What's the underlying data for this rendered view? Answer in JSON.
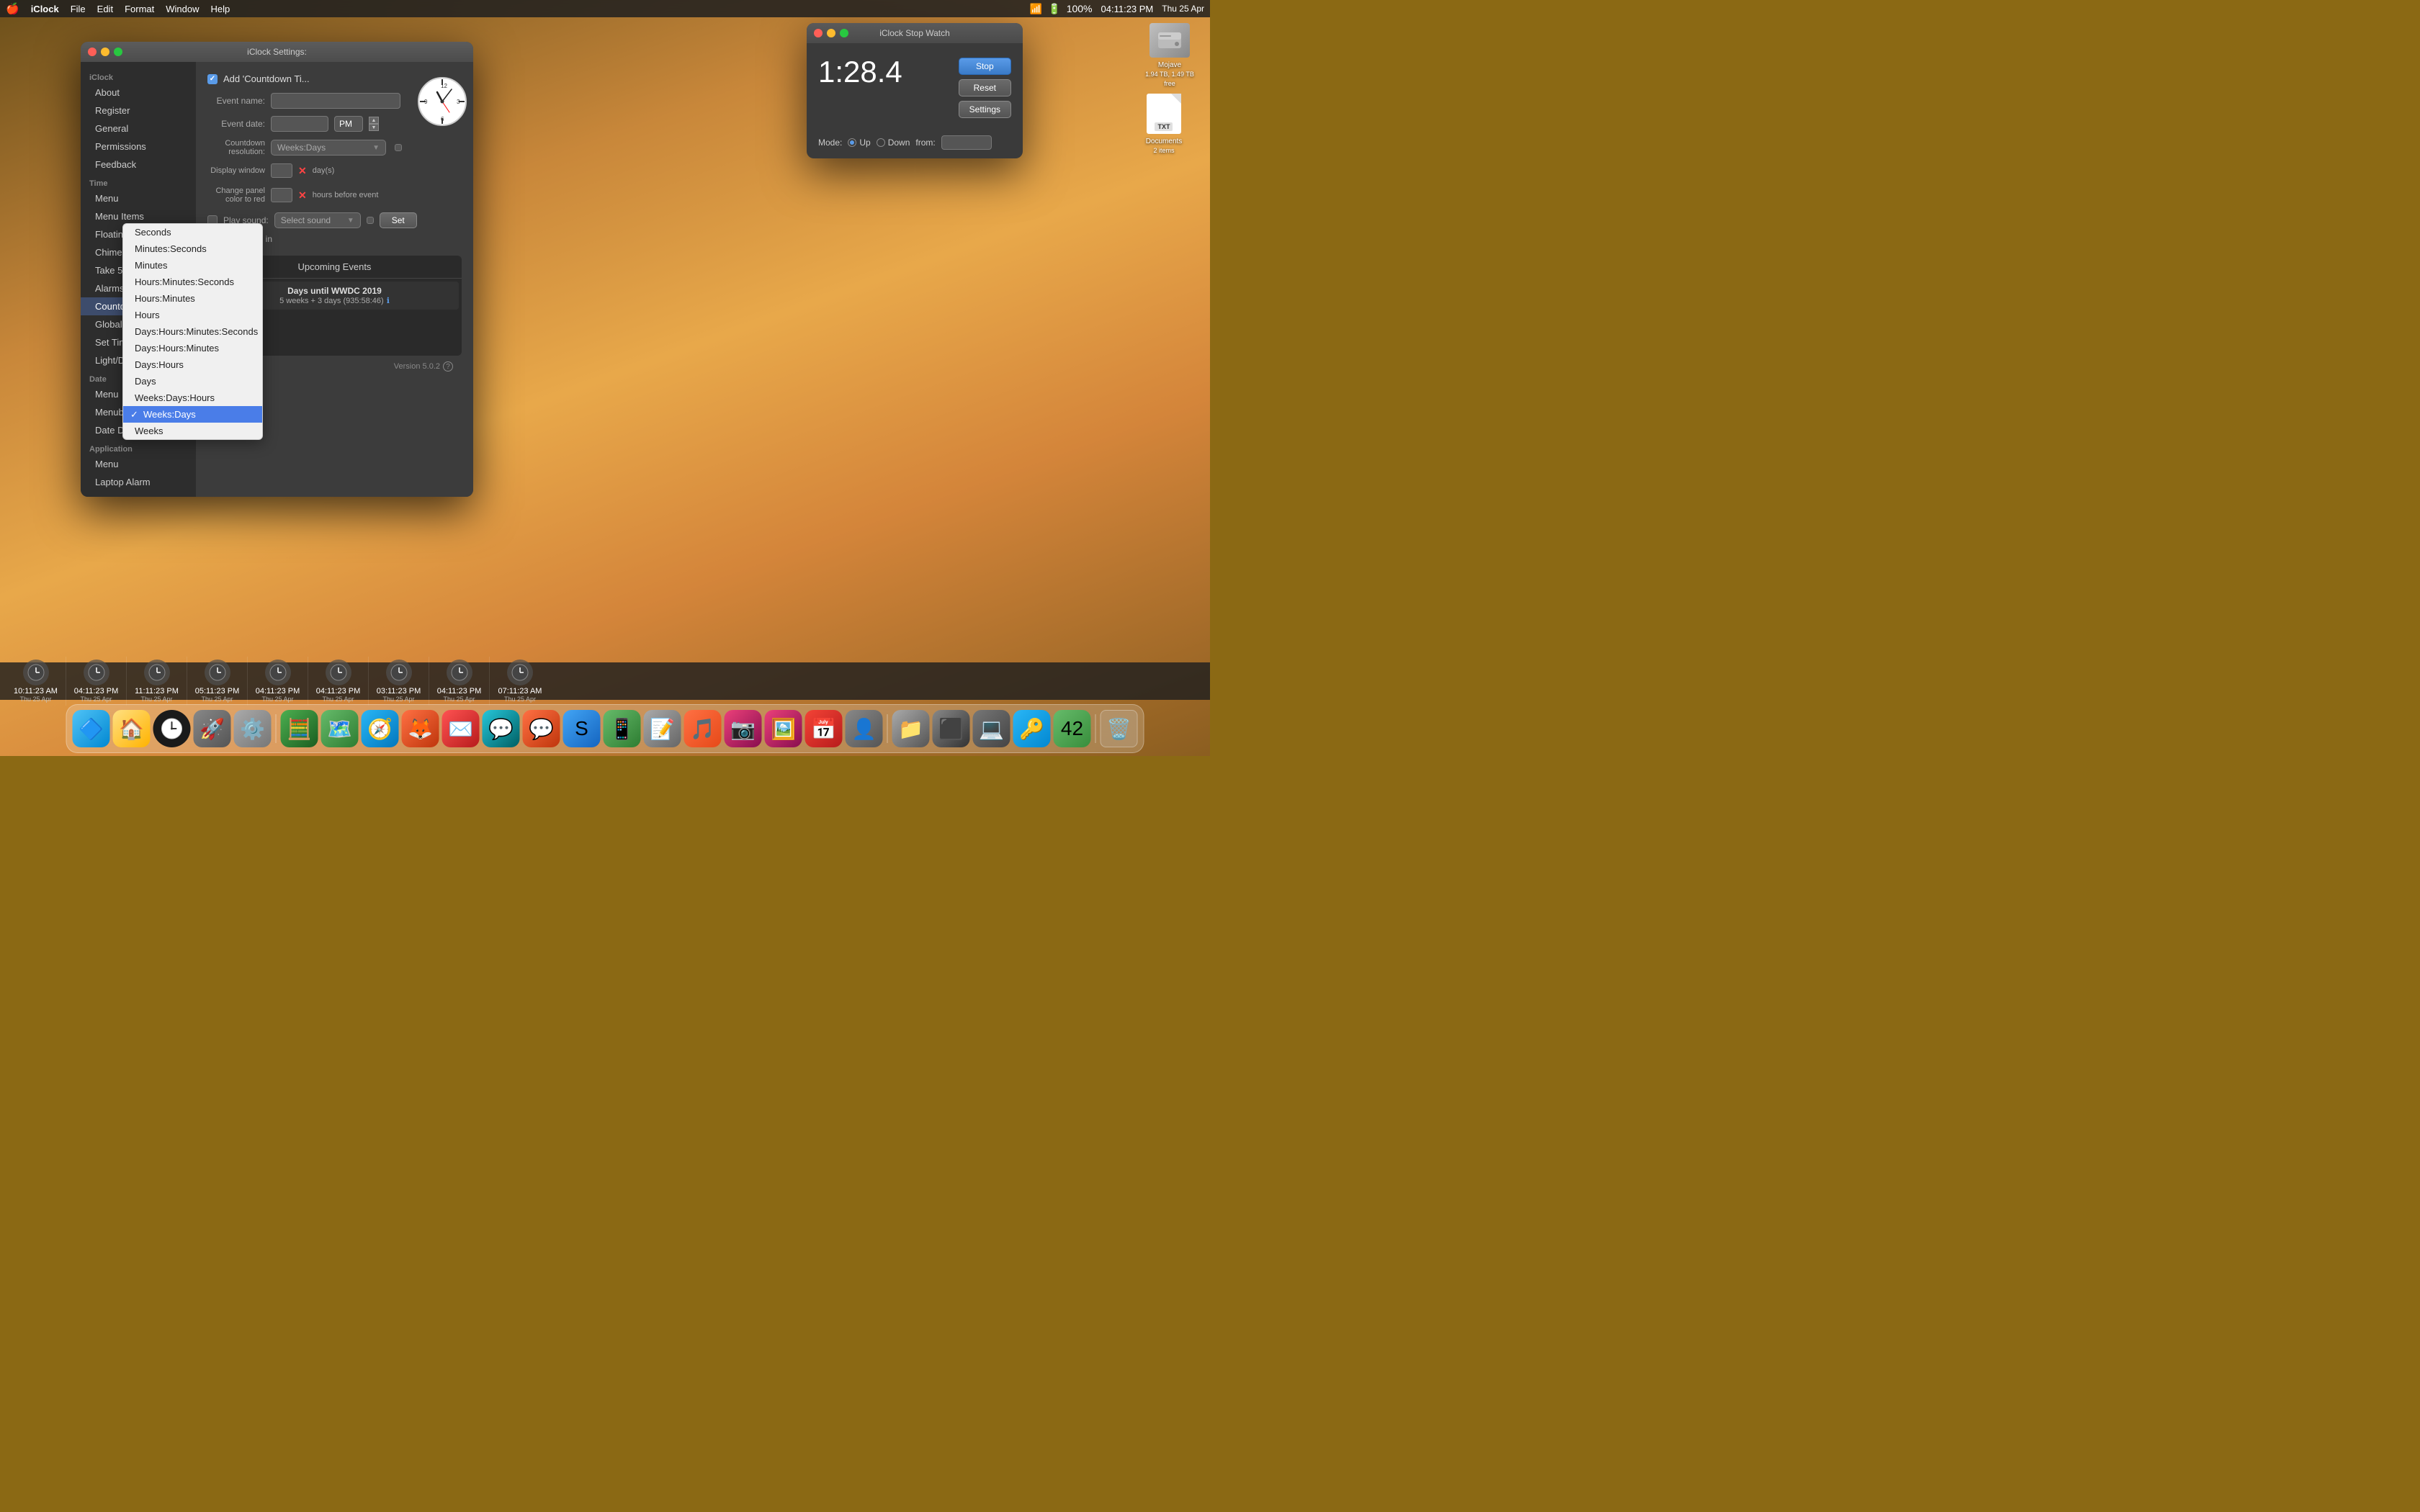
{
  "menubar": {
    "apple": "🍎",
    "app_name": "iClock",
    "menus": [
      "File",
      "Edit",
      "Format",
      "Window",
      "Help"
    ],
    "clock_display": "04:11:23 PM",
    "date_display": "Thu 25 Apr",
    "battery": "100%"
  },
  "desktop": {
    "icons": [
      {
        "id": "mojave-hdd",
        "label": "Mojave\n1.94 TB, 1.49 TB free",
        "type": "hdd"
      },
      {
        "id": "documents",
        "label": "Documents\n2 items",
        "type": "folder"
      }
    ]
  },
  "stopwatch": {
    "title": "iClock Stop Watch",
    "time": "1:28.4",
    "buttons": {
      "stop": "Stop",
      "reset": "Reset",
      "settings": "Settings"
    },
    "mode_label": "Mode:",
    "mode_up": "Up",
    "mode_down": "Down",
    "from_label": "from:"
  },
  "settings": {
    "title": "iClock Settings:",
    "sidebar": {
      "iclock_header": "iClock",
      "iclock_items": [
        "About",
        "Register",
        "General",
        "Permissions",
        "Feedback"
      ],
      "time_header": "Time",
      "time_items": [
        "Menu",
        "Menu Items",
        "Floating Clocks",
        "Chimes",
        "Take 5",
        "Alarms",
        "Countdown Timer",
        "Global Scheduler",
        "Set Time Zone",
        "Light/Dark Mode"
      ],
      "date_header": "Date",
      "date_items": [
        "Menu",
        "Menubar Calendar",
        "Date Difference"
      ],
      "app_header": "Application",
      "app_items": [
        "Menu",
        "Laptop Alarm"
      ]
    },
    "active_item": "Countdown Timer",
    "main": {
      "add_countdown_label": "Add 'Countdown Ti...",
      "event_name_label": "Event name:",
      "event_date_label": "Event date:",
      "time_value": "PM",
      "countdown_resolution_label": "Countdown resolution:",
      "display_window_label": "Display window",
      "change_color_label": "Change panel color to red",
      "hours_label": "hours before event",
      "play_sound_label": "Play sound:",
      "select_sound_label": "Select sound",
      "set_button": "Set",
      "fade_in_label": "Fade in",
      "upcoming_header": "Upcoming Events",
      "event_title": "Days until WWDC 2019",
      "event_countdown": "5 weeks + 3 days (935:58:46)",
      "version_label": "Version 5.0.2"
    }
  },
  "resolution_dropdown": {
    "options": [
      "Seconds",
      "Minutes:Seconds",
      "Minutes",
      "Hours:Minutes:Seconds",
      "Hours:Minutes",
      "Hours",
      "Days:Hours:Minutes:Seconds",
      "Days:Hours:Minutes",
      "Days:Hours",
      "Days",
      "Weeks:Days:Hours",
      "Weeks:Days",
      "Weeks"
    ],
    "selected": "Weeks:Days"
  },
  "bottom_clocks": [
    {
      "time": "10:11:23 AM",
      "date": "Thu 25 Apr"
    },
    {
      "time": "04:11:23 PM",
      "date": "Thu 25 Apr"
    },
    {
      "time": "11:11:23 PM",
      "date": "Thu 25 Apr"
    },
    {
      "time": "05:11:23 PM",
      "date": "Thu 25 Apr"
    },
    {
      "time": "04:11:23 PM",
      "date": "Thu 25 Apr"
    },
    {
      "time": "04:11:23 PM",
      "date": "Thu 25 Apr"
    },
    {
      "time": "03:11:23 PM",
      "date": "Thu 25 Apr"
    },
    {
      "time": "04:11:23 PM",
      "date": "Thu 25 Apr"
    },
    {
      "time": "07:11:23 AM",
      "date": "Thu 25 Apr"
    }
  ],
  "dock_icons": [
    {
      "id": "finder",
      "emoji": "🔷",
      "color": "#4FC3F7"
    },
    {
      "id": "home",
      "emoji": "🏠",
      "color": "#FFD54F"
    },
    {
      "id": "iclock",
      "emoji": "🕐",
      "color": "#2d2d2d"
    },
    {
      "id": "launchpad",
      "emoji": "🚀",
      "color": "#888"
    },
    {
      "id": "systemprefs",
      "emoji": "⚙️",
      "color": "#999"
    },
    {
      "id": "maps",
      "emoji": "🗺️",
      "color": "#66BB6A"
    },
    {
      "id": "safari",
      "emoji": "🧭",
      "color": "#29B6F6"
    },
    {
      "id": "firefox",
      "emoji": "🦊",
      "color": "#FF7043"
    },
    {
      "id": "mail",
      "emoji": "✉️",
      "color": "#42A5F5"
    },
    {
      "id": "skype",
      "emoji": "💬",
      "color": "#00BCD4"
    },
    {
      "id": "music",
      "emoji": "🎵",
      "color": "#FF7043"
    },
    {
      "id": "photos",
      "emoji": "📷",
      "color": "#E91E63"
    },
    {
      "id": "calendar",
      "emoji": "📅",
      "color": "#F44336"
    },
    {
      "id": "trash",
      "emoji": "🗑️",
      "color": "#888"
    }
  ]
}
